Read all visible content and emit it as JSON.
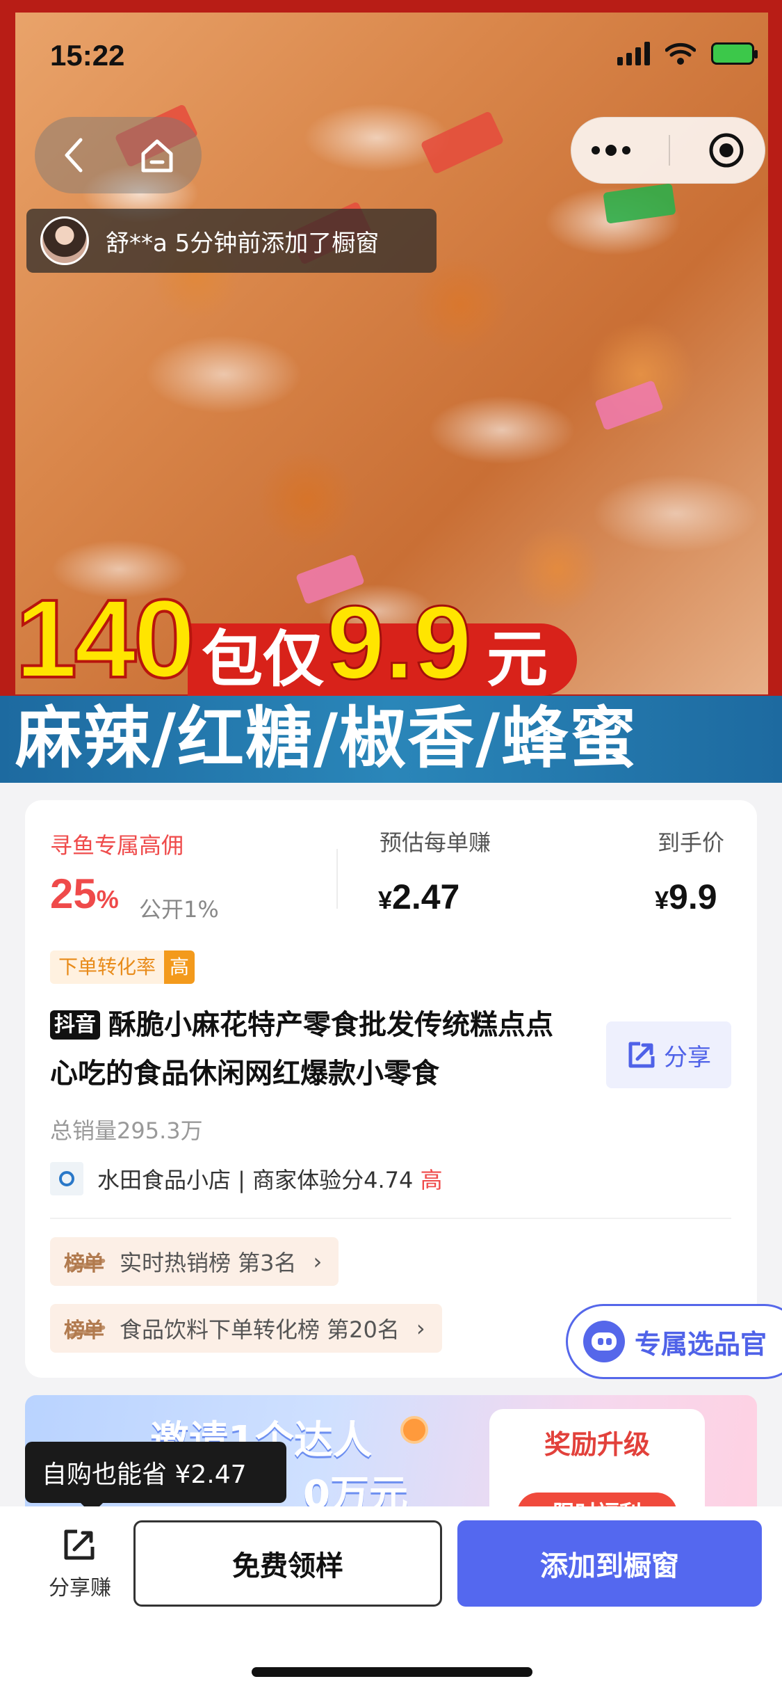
{
  "status_bar": {
    "time": "15:22"
  },
  "hero": {
    "promo_count": "140",
    "promo_unit": "包仅",
    "promo_price": "9.9",
    "promo_currency": "元",
    "flavors": "麻辣/红糖/椒香/蜂蜜"
  },
  "toast": {
    "text": "舒**a 5分钟前添加了橱窗"
  },
  "commission": {
    "label": "寻鱼专属高佣",
    "rate": "25",
    "rate_unit": "%",
    "public_rate": "公开1%",
    "per_order_label": "预估每单赚",
    "per_order_value": "2.47",
    "final_price_label": "到手价",
    "final_price_value": "9.9",
    "currency_symbol": "¥"
  },
  "conversion_tag": {
    "label": "下单转化率",
    "level": "高"
  },
  "product": {
    "platform_badge": "抖音",
    "title": "酥脆小麻花特产零食批发传统糕点点心吃的食品休闲网红爆款小零食",
    "share_label": "分享",
    "total_sales": "总销量295.3万"
  },
  "shop": {
    "name_score": "水田食品小店 | 商家体验分4.74",
    "score_level": "高"
  },
  "rankings": [
    {
      "icon_text": "榜单",
      "text": "实时热销榜 第3名"
    },
    {
      "icon_text": "榜单",
      "text": "食品饮料下单转化榜 第20名"
    }
  ],
  "guide_button": {
    "label": "专属选品官"
  },
  "banner": {
    "line1": "邀请1个达人",
    "line2": "0万元",
    "reward_title": "奖励升级",
    "reward_tag": "限时福利"
  },
  "tooltip": {
    "text": "自购也能省 ¥2.47"
  },
  "bottom_bar": {
    "share_label": "分享赚",
    "sample_button": "免费领样",
    "add_button": "添加到橱窗"
  },
  "colors": {
    "accent_blue": "#5468ef",
    "price_red": "#ef4a4a",
    "tag_orange": "#f39a1c"
  }
}
